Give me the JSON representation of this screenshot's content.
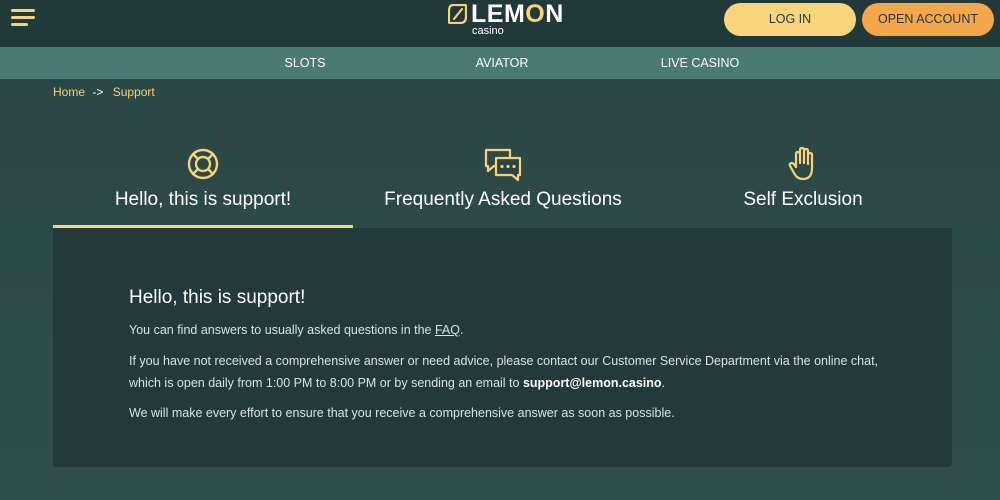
{
  "header": {
    "logo": {
      "word_start": "LEM",
      "word_accent": "O",
      "word_end": "N",
      "sub": "casino"
    },
    "login_label": "LOG IN",
    "open_account_label": "OPEN ACCOUNT"
  },
  "nav": {
    "items": [
      {
        "label": "SLOTS"
      },
      {
        "label": "AVIATOR"
      },
      {
        "label": "LIVE CASINO"
      }
    ]
  },
  "breadcrumb": {
    "home": "Home",
    "separator": "->",
    "current": "Support"
  },
  "tabs": [
    {
      "label": "Hello, this is support!",
      "icon": "lifebuoy-icon",
      "active": true
    },
    {
      "label": "Frequently Asked Questions",
      "icon": "chat-bubbles-icon",
      "active": false
    },
    {
      "label": "Self Exclusion",
      "icon": "hand-stop-icon",
      "active": false
    }
  ],
  "content": {
    "title": "Hello, this is support!",
    "p1_before": "You can find answers to usually asked questions in the ",
    "p1_link": "FAQ",
    "p1_after": ".",
    "p2_before": "If you have not received a comprehensive answer or need advice, please contact our Customer Service Department via the online chat, which is open daily from 1:00 PM to 8:00 PM or by sending an email to ",
    "p2_email": "support@lemon.casino",
    "p2_after": ".",
    "p3": "We will make every effort to ensure that you receive a comprehensive answer as soon as possible."
  },
  "colors": {
    "accent": "#f6d27a",
    "login_button": "#fbd47e",
    "open_account_button": "#f4a64a",
    "nav_strip": "#4a7a74",
    "header_bg": "#22393a",
    "panel_bg": "#23393a"
  }
}
